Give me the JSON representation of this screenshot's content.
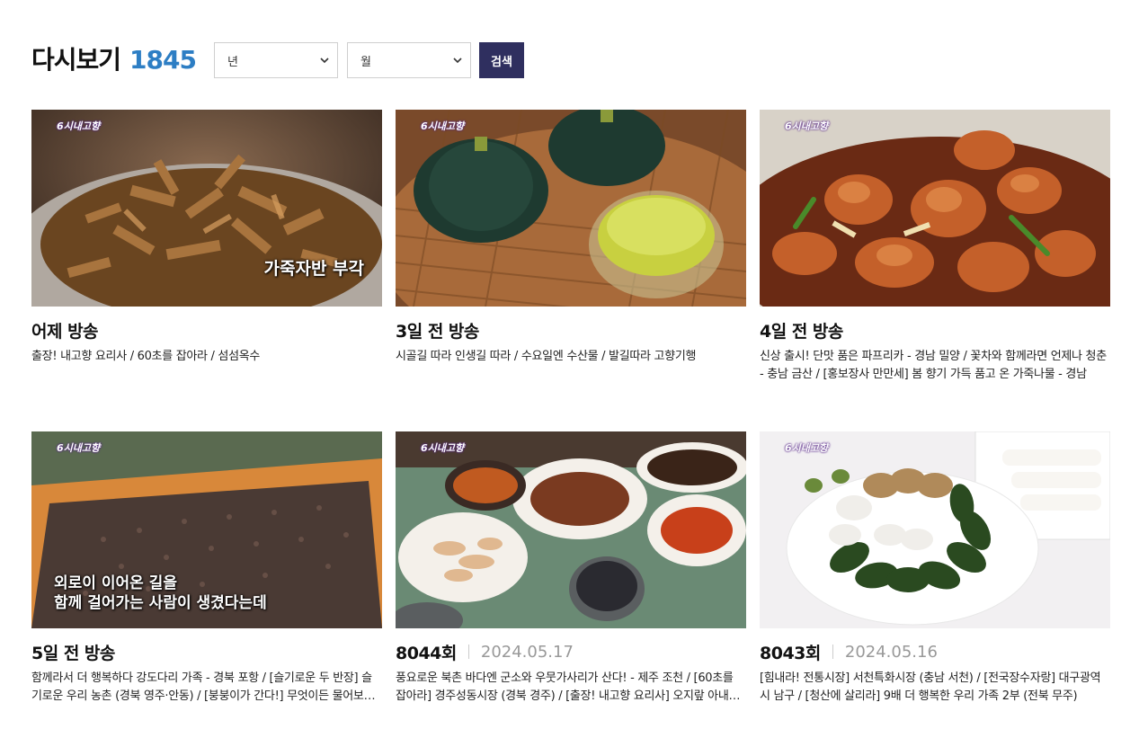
{
  "header": {
    "title": "다시보기",
    "count": "1845"
  },
  "filters": {
    "year": {
      "selected": "년"
    },
    "month": {
      "selected": "월"
    },
    "search_label": "검색"
  },
  "cards": [
    {
      "ago": "어제 방송",
      "episode": "",
      "date": "",
      "desc": "출장! 내고향 요리사 / 60초를 잡아라 / 섬섬옥수",
      "overlay": "가죽자반 부각",
      "thumb_icon": "fried-snack-thumbnail"
    },
    {
      "ago": "3일 전 방송",
      "episode": "",
      "date": "",
      "desc": "시골길 따라 인생길 따라 / 수요일엔 수산물 / 발길따라 고향기행",
      "overlay": "",
      "thumb_icon": "pumpkin-thumbnail"
    },
    {
      "ago": "4일 전 방송",
      "episode": "",
      "date": "",
      "desc": "신상 출시! 단맛 품은 파프리카 - 경남 밀양 / 꽃차와 함께라면 언제나 청춘 - 충남 금산 / [홍보장사 만만세] 봄 향기 가득 품고 온 가죽나물 - 경남",
      "overlay": "",
      "thumb_icon": "braised-chicken-thumbnail"
    },
    {
      "ago": "5일 전 방송",
      "episode": "",
      "date": "",
      "desc": "함께라서 더 행복하다 강도다리 가족 - 경북 포항 / [슬기로운 두 반장] 슬기로운 우리 농촌 (경북 영주·안동) / [붕붕이가 간다!] 무엇이든 물어보세요",
      "overlay": "외로이 이어온 길을\n함께 걸어가는 사람이 생겼다는데",
      "thumb_icon": "fish-feed-thumbnail"
    },
    {
      "ago": "",
      "episode": "8044회",
      "date": "2024.05.17",
      "desc": "풍요로운 북촌 바다엔 군소와 우뭇가사리가 산다! - 제주 조천 / [60초를 잡아라] 경주성동시장 (경북 경주) / [출장! 내고향 요리사] 오지랖 아내를 소개합니다",
      "overlay": "",
      "thumb_icon": "seafood-table-thumbnail"
    },
    {
      "ago": "",
      "episode": "8043회",
      "date": "2024.05.16",
      "desc": "[힘내라! 전통시장] 서천특화시장 (충남 서천) / [전국장수자랑] 대구광역시 남구 / [청산에 살리라] 9배 더 행복한 우리 가족 2부 (전북 무주)",
      "overlay": "",
      "thumb_icon": "rice-cake-thumbnail"
    }
  ]
}
